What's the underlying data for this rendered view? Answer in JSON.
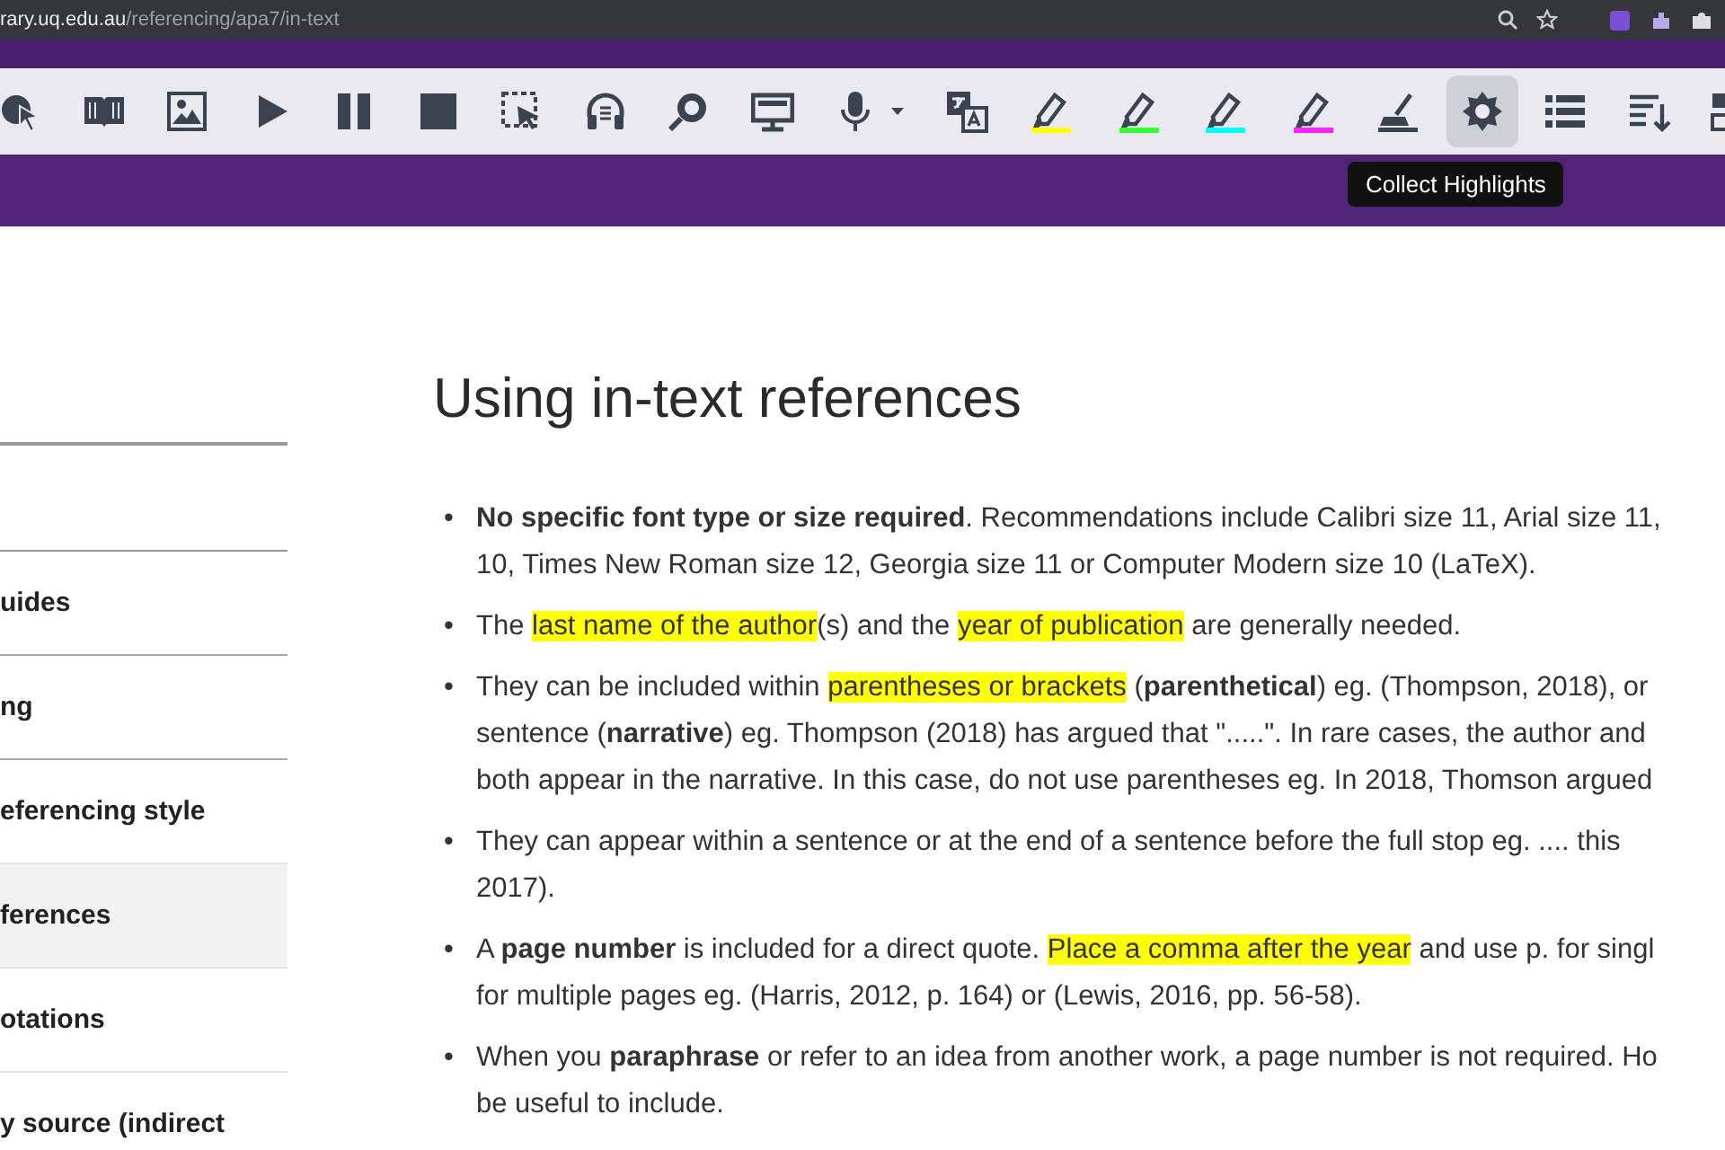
{
  "browser": {
    "url_domain": "rary.uq.edu.au",
    "url_path": "/referencing/apa7/in-text"
  },
  "toolbar": {
    "buttons": [
      {
        "kind": "click-speak",
        "selected": false
      },
      {
        "kind": "book",
        "selected": false
      },
      {
        "kind": "image",
        "selected": false
      },
      {
        "kind": "play",
        "selected": false
      },
      {
        "kind": "pause",
        "selected": false
      },
      {
        "kind": "stop",
        "selected": false
      },
      {
        "kind": "select",
        "selected": false
      },
      {
        "kind": "headphones",
        "selected": false
      },
      {
        "kind": "magnifier",
        "selected": false
      },
      {
        "kind": "monitor",
        "selected": false
      },
      {
        "kind": "mic",
        "selected": false
      },
      {
        "kind": "translate",
        "selected": false
      },
      {
        "kind": "highlighter",
        "selected": false,
        "color": "#ffff00"
      },
      {
        "kind": "highlighter",
        "selected": false,
        "color": "#33ff33"
      },
      {
        "kind": "highlighter",
        "selected": false,
        "color": "#00ffff"
      },
      {
        "kind": "highlighter",
        "selected": false,
        "color": "#ff22ff"
      },
      {
        "kind": "clear",
        "selected": false
      },
      {
        "kind": "collect",
        "selected": true
      },
      {
        "kind": "list",
        "selected": false
      },
      {
        "kind": "sort",
        "selected": false
      },
      {
        "kind": "layout",
        "selected": false
      }
    ],
    "tooltip": "Collect Highlights"
  },
  "sidebar": {
    "items": [
      {
        "label": "uides",
        "selected": false
      },
      {
        "label": "ng",
        "selected": false
      },
      {
        "label": "eferencing style",
        "selected": false
      },
      {
        "label": "ferences",
        "selected": true
      },
      {
        "label": "otations",
        "selected": false
      },
      {
        "label": "y source (indirect",
        "selected": false
      }
    ]
  },
  "article": {
    "heading": "Using in-text references",
    "bullets": [
      {
        "marker": "•",
        "lines": [
          [
            {
              "kind": "bold",
              "text": "No specific font type or size required"
            },
            {
              "kind": "plain",
              "text": ". Recommendations include Calibri size 11, Arial size 11,"
            }
          ],
          [
            {
              "kind": "plain",
              "text": "10, Times New Roman size 12, Georgia size 11 or Computer Modern size 10 (LaTeX)."
            }
          ]
        ]
      },
      {
        "marker": "•",
        "lines": [
          [
            {
              "kind": "plain",
              "text": "The "
            },
            {
              "kind": "highlight",
              "text": "last name of the author"
            },
            {
              "kind": "plain",
              "text": "(s) and the "
            },
            {
              "kind": "highlight",
              "text": "year of publication"
            },
            {
              "kind": "plain",
              "text": " are generally needed."
            }
          ]
        ]
      },
      {
        "marker": "•",
        "lines": [
          [
            {
              "kind": "plain",
              "text": "They can be included within "
            },
            {
              "kind": "highlight",
              "text": "parentheses or brackets"
            },
            {
              "kind": "plain",
              "text": " ("
            },
            {
              "kind": "bold",
              "text": "parenthetical"
            },
            {
              "kind": "plain",
              "text": ") eg. (Thompson, 2018), or"
            }
          ],
          [
            {
              "kind": "plain",
              "text": "sentence ("
            },
            {
              "kind": "bold",
              "text": "narrative"
            },
            {
              "kind": "plain",
              "text": ") eg. Thompson (2018) has argued that \".....\". In rare cases, the author and"
            }
          ],
          [
            {
              "kind": "plain",
              "text": "both appear in the narrative. In this case, do not use parentheses eg. In 2018, Thomson argued"
            }
          ]
        ]
      },
      {
        "marker": "•",
        "lines": [
          [
            {
              "kind": "plain",
              "text": "They can appear within a sentence or at the end of a sentence before the full stop eg. .... this"
            }
          ],
          [
            {
              "kind": "plain",
              "text": "2017)."
            }
          ]
        ]
      },
      {
        "marker": "•",
        "lines": [
          [
            {
              "kind": "plain",
              "text": "A "
            },
            {
              "kind": "bold",
              "text": "page number"
            },
            {
              "kind": "plain",
              "text": " is included for a direct quote. "
            },
            {
              "kind": "highlight",
              "text": "Place a comma after the year"
            },
            {
              "kind": "plain",
              "text": " and use p. for singl"
            }
          ],
          [
            {
              "kind": "plain",
              "text": "for multiple pages eg. (Harris, 2012, p. 164) or (Lewis, 2016, pp. 56-58)."
            }
          ]
        ]
      },
      {
        "marker": "•",
        "lines": [
          [
            {
              "kind": "plain",
              "text": "When you "
            },
            {
              "kind": "bold",
              "text": "paraphrase"
            },
            {
              "kind": "plain",
              "text": " or refer to an idea from another work, a page number is not required. Ho"
            }
          ],
          [
            {
              "kind": "plain",
              "text": "be useful to include."
            }
          ]
        ]
      }
    ]
  }
}
